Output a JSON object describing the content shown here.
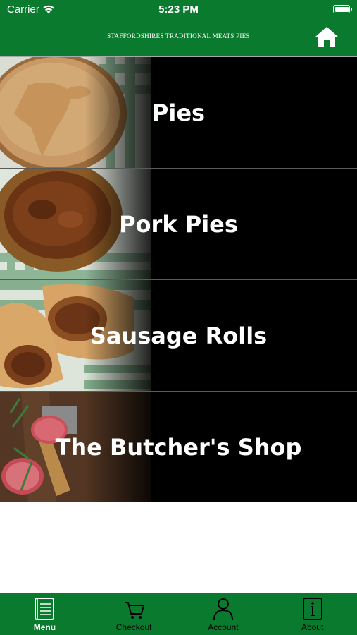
{
  "status_bar": {
    "carrier": "Carrier",
    "time": "5:23 PM"
  },
  "header": {
    "title": "STAFFORDSHIRES TRADITIONAL MEATS PIES",
    "home_icon": "home-icon"
  },
  "colors": {
    "brand_green": "#0a7a2e",
    "row_background": "#000000",
    "active_tab": "#ffffff"
  },
  "menu": {
    "items": [
      {
        "label": "Pies"
      },
      {
        "label": "Pork Pies"
      },
      {
        "label": "Sausage Rolls"
      },
      {
        "label": "The Butcher's Shop"
      }
    ]
  },
  "tabbar": {
    "tabs": [
      {
        "label": "Menu",
        "icon": "menu-book-icon",
        "active": true
      },
      {
        "label": "Checkout",
        "icon": "cart-icon",
        "active": false
      },
      {
        "label": "Account",
        "icon": "person-icon",
        "active": false
      },
      {
        "label": "About",
        "icon": "info-icon",
        "active": false
      }
    ]
  }
}
